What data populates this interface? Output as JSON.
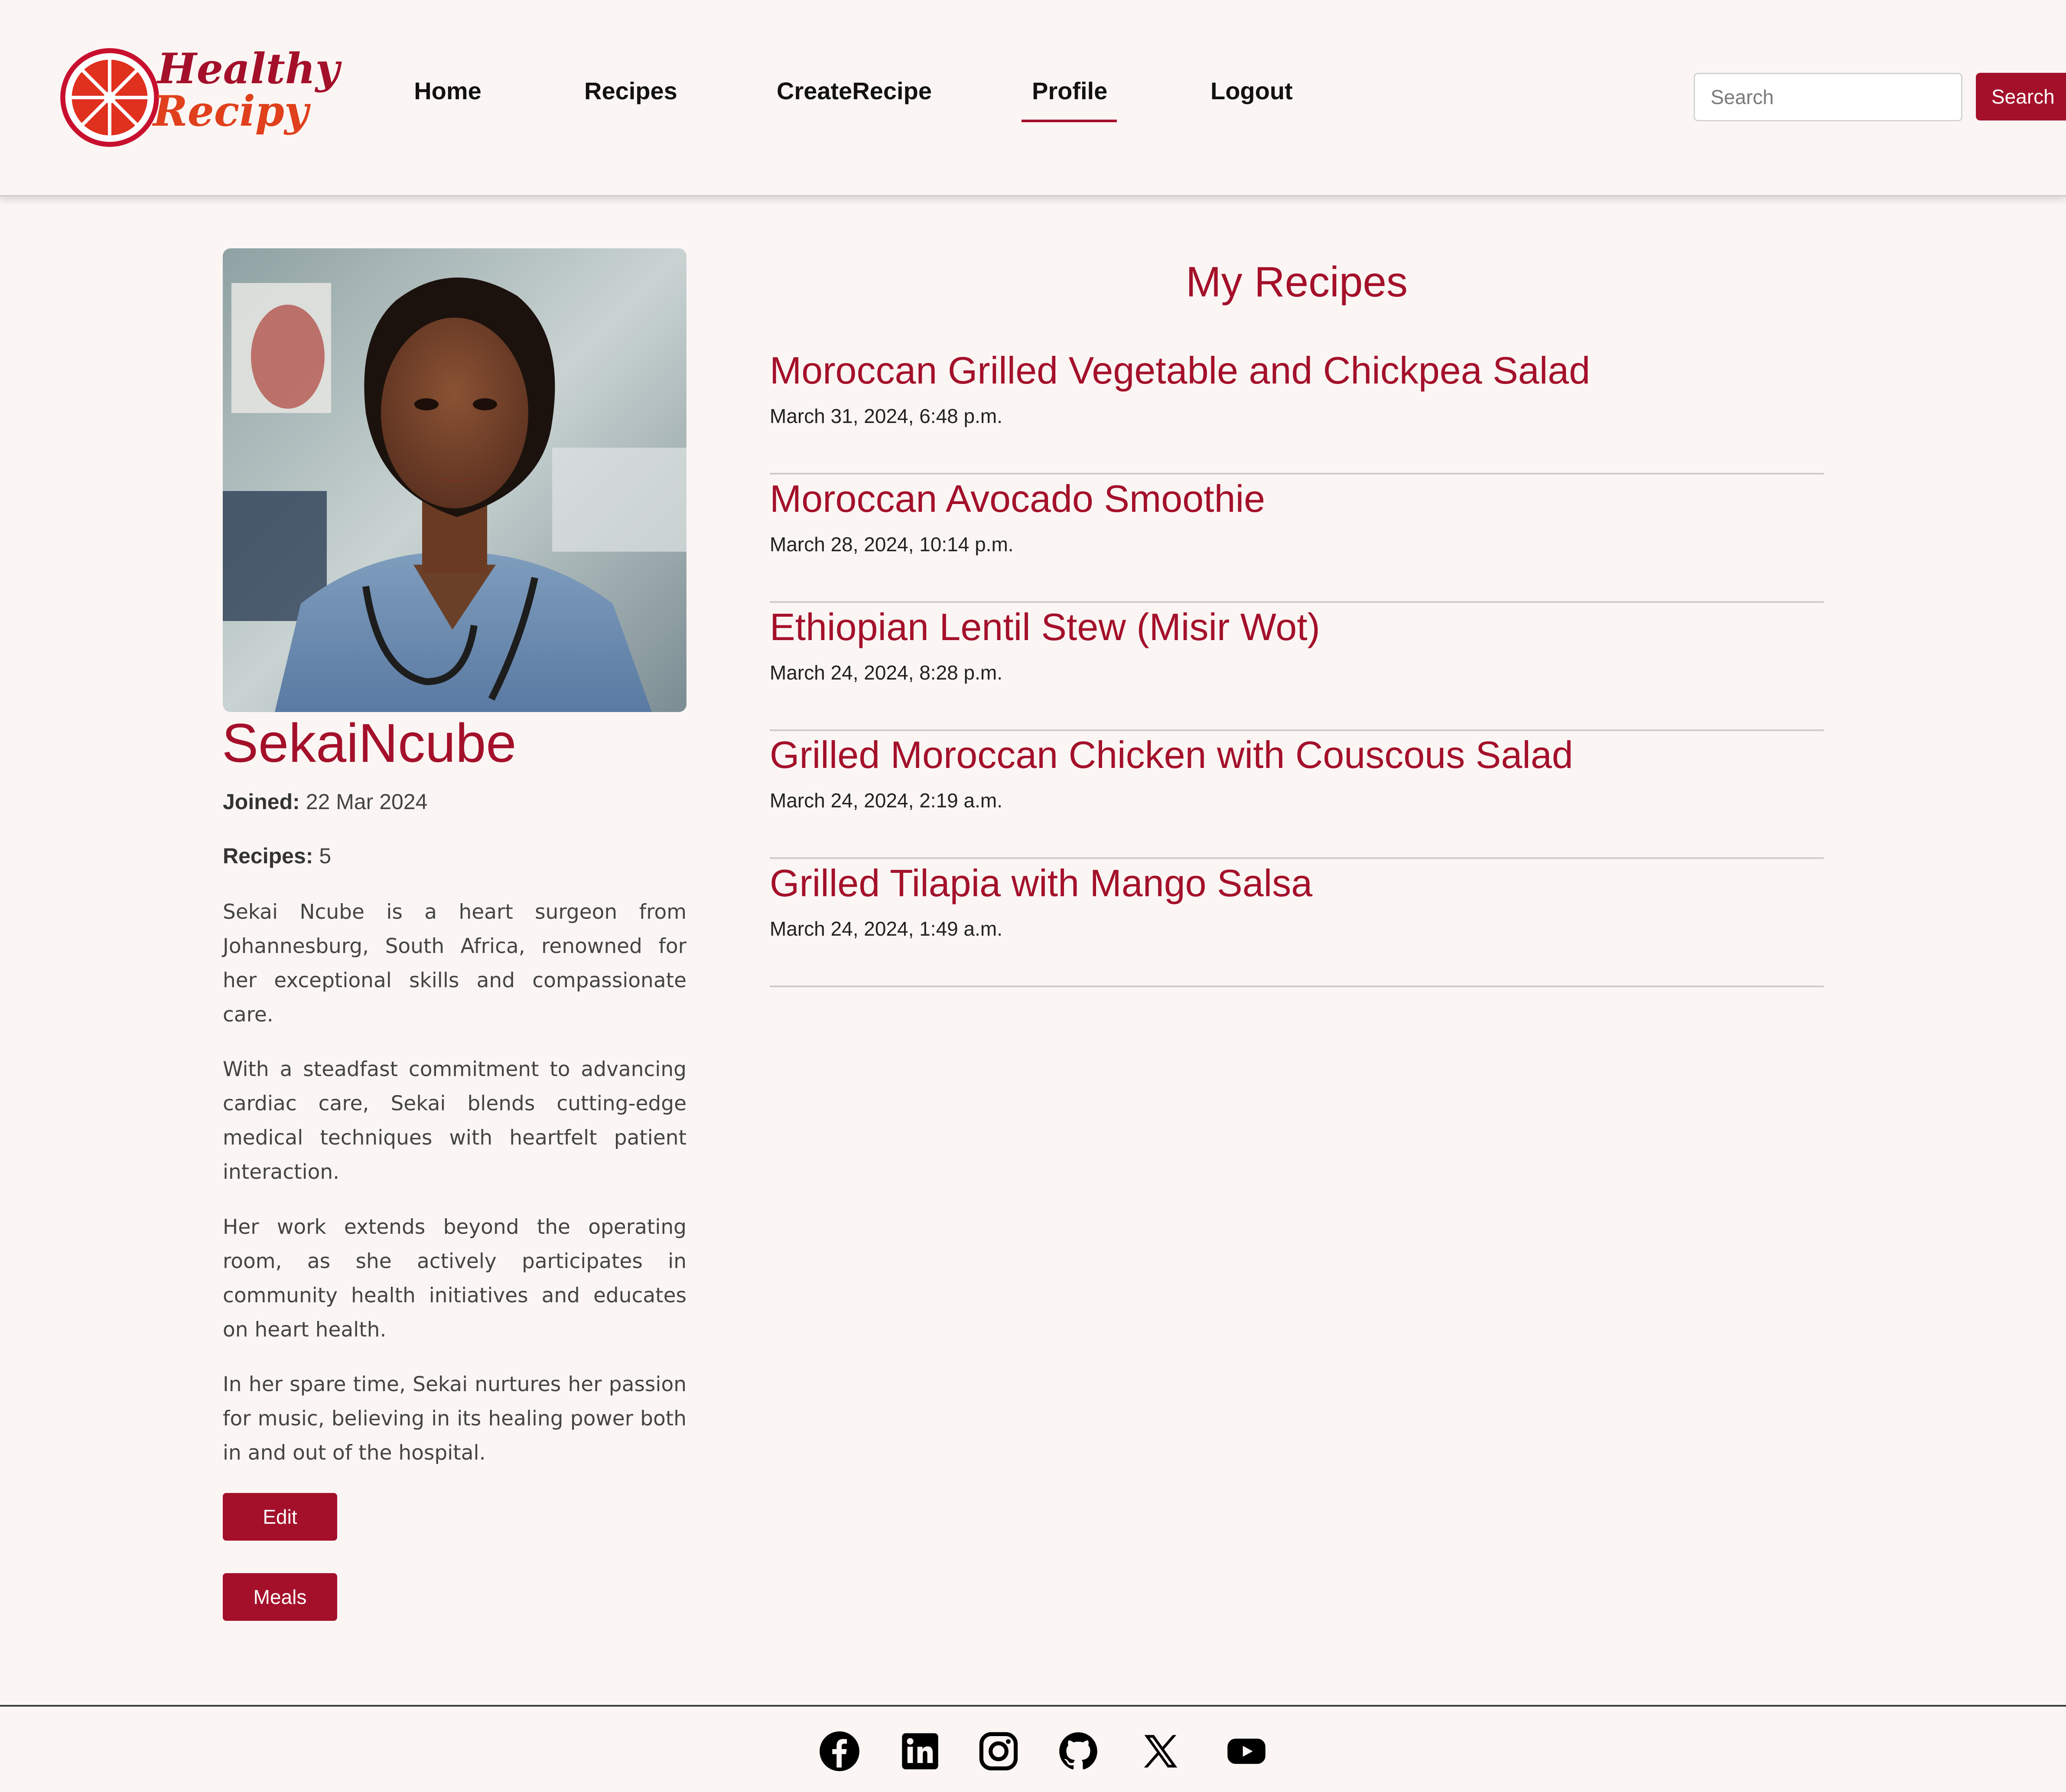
{
  "brand": {
    "logo_line1": "Healthy",
    "logo_line2": "Recipy",
    "accent": "#a4102a"
  },
  "nav": {
    "items": [
      {
        "label": "Home",
        "active": false
      },
      {
        "label": "Recipes",
        "active": false
      },
      {
        "label": "CreateRecipe",
        "active": false
      },
      {
        "label": "Profile",
        "active": true
      },
      {
        "label": "Logout",
        "active": false
      }
    ]
  },
  "search": {
    "placeholder": "Search",
    "button_label": "Search"
  },
  "profile": {
    "name": "SekaiNcube",
    "joined_label": "Joined:",
    "joined_value": " 22 Mar 2024",
    "recipes_label": "Recipes:",
    "recipes_value": " 5",
    "bio": [
      "Sekai Ncube is a heart surgeon from Johannesburg, South Africa, renowned for her exceptional skills and compassionate care.",
      "With a steadfast commitment to advancing cardiac care, Sekai blends cutting-edge medical techniques with heartfelt patient interaction.",
      "Her work extends beyond the operating room, as she actively participates in community health initiatives and educates on heart health.",
      "In her spare time, Sekai nurtures her passion for music, believing in its healing power both in and out of the hospital."
    ],
    "edit_label": "Edit",
    "meals_label": "Meals"
  },
  "recipes": {
    "title": "My Recipes",
    "items": [
      {
        "title": "Moroccan Grilled Vegetable and Chickpea Salad",
        "date": "March 31, 2024, 6:48 p.m."
      },
      {
        "title": "Moroccan Avocado Smoothie",
        "date": "March 28, 2024, 10:14 p.m."
      },
      {
        "title": "Ethiopian Lentil Stew (Misir Wot)",
        "date": "March 24, 2024, 8:28 p.m."
      },
      {
        "title": "Grilled Moroccan Chicken with Couscous Salad",
        "date": "March 24, 2024, 2:19 a.m."
      },
      {
        "title": "Grilled Tilapia with Mango Salsa",
        "date": "March 24, 2024, 1:49 a.m."
      }
    ]
  },
  "footer": {
    "icons": [
      "facebook-icon",
      "linkedin-icon",
      "instagram-icon",
      "github-icon",
      "x-icon",
      "youtube-icon"
    ]
  }
}
